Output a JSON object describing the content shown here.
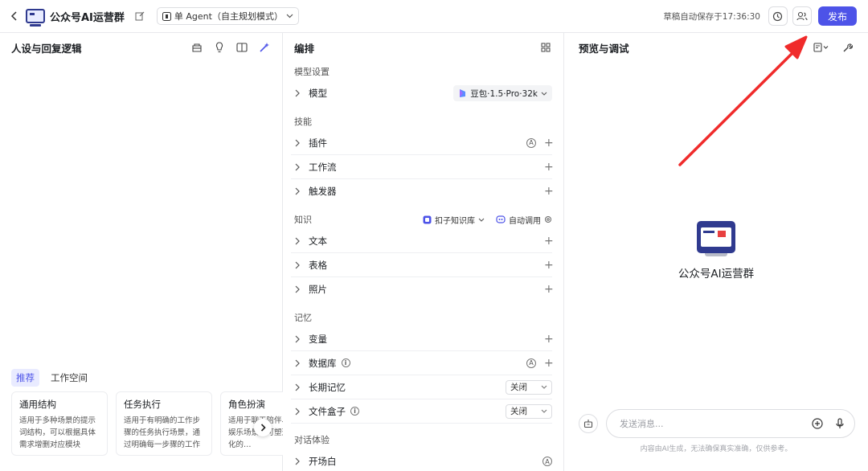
{
  "header": {
    "app_title": "公众号AI运营群",
    "agent_mode": "单 Agent（自主规划模式）",
    "save_status": "草稿自动保存于17:36:30",
    "publish_label": "发布"
  },
  "left_panel": {
    "title": "人设与回复逻辑",
    "template_tabs": [
      "推荐",
      "工作空间"
    ],
    "templates": [
      {
        "title": "通用结构",
        "desc": "适用于多种场景的提示词结构，可以根据具体需求增删对应模块"
      },
      {
        "title": "任务执行",
        "desc": "适用于有明确的工作步骤的任务执行场景，通过明确每一步骤的工作要求…"
      },
      {
        "title": "角色扮演",
        "desc": "适用于聊天陪伴、互动娱乐场景，可塑造个性化的…"
      }
    ]
  },
  "mid_panel": {
    "title": "编排",
    "model_section": {
      "label": "模型设置",
      "model_row": "模型",
      "model_value": "豆包·1.5·Pro·32k"
    },
    "skills_section": {
      "label": "技能",
      "rows": [
        "插件",
        "工作流",
        "触发器"
      ]
    },
    "knowledge_section": {
      "label": "知识",
      "kb_source": "扣子知识库",
      "auto_call": "自动调用",
      "rows": [
        "文本",
        "表格",
        "照片"
      ]
    },
    "memory_section": {
      "label": "记忆",
      "variables": "变量",
      "database": "数据库",
      "long_memory": "长期记忆",
      "long_memory_value": "关闭",
      "file_box": "文件盒子",
      "file_box_value": "关闭"
    },
    "dialog_section": {
      "label": "对话体验",
      "opening": "开场白"
    }
  },
  "right_panel": {
    "title": "预览与调试",
    "bot_name": "公众号AI运营群",
    "input_placeholder": "发送消息...",
    "disclaimer": "内容由AI生成，无法确保真实准确，仅供参考。"
  },
  "colors": {
    "accent": "#4d53e8",
    "annotation_arrow": "#f02b2b"
  }
}
